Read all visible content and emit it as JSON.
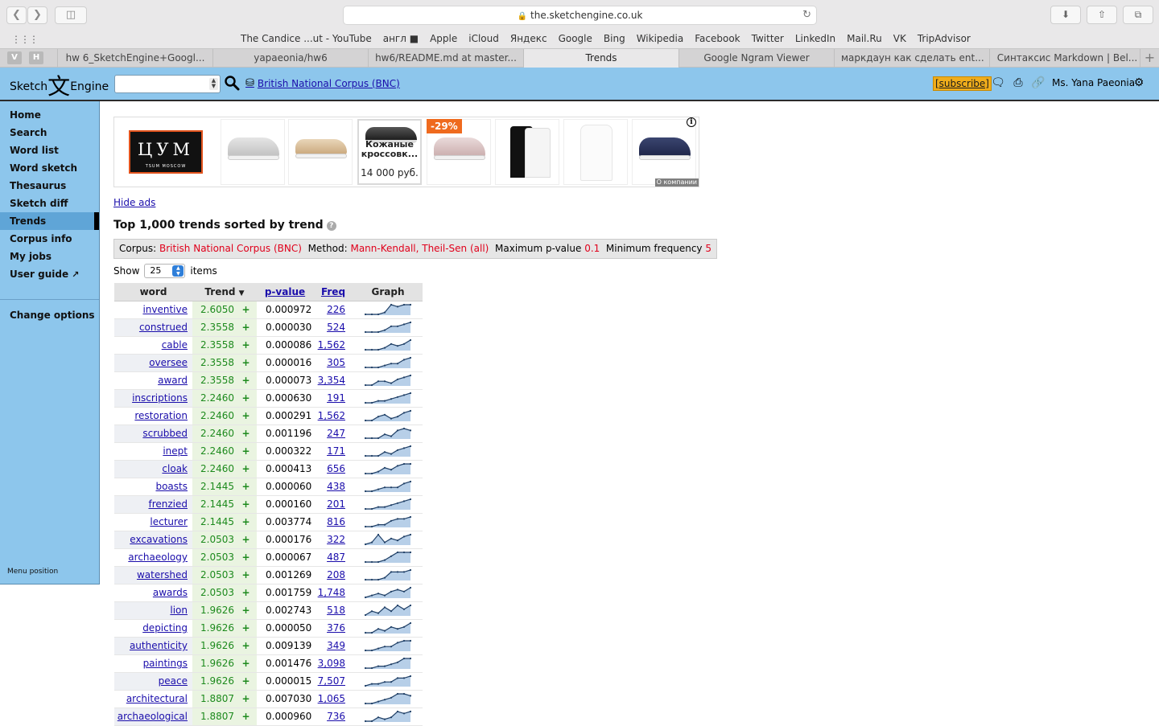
{
  "browser": {
    "url": "the.sketchengine.co.uk",
    "bookmarks": [
      "The Candice ...ut - YouTube",
      "англ ■",
      "Apple",
      "iCloud",
      "Яндекс",
      "Google",
      "Bing",
      "Wikipedia",
      "Facebook",
      "Twitter",
      "LinkedIn",
      "Mail.Ru",
      "VK",
      "TripAdvisor"
    ],
    "pinned_tabs": [
      "V",
      "H"
    ],
    "tabs": [
      {
        "label": "hw 6_SketchEngine+Googl...",
        "active": false
      },
      {
        "label": "yapaeonia/hw6",
        "active": false
      },
      {
        "label": "hw6/README.md at master...",
        "active": false
      },
      {
        "label": "Trends",
        "active": true
      },
      {
        "label": "Google Ngram Viewer",
        "active": false
      },
      {
        "label": "маркдаун как сделать ent...",
        "active": false
      },
      {
        "label": "Синтаксис Markdown | Bel...",
        "active": false
      }
    ]
  },
  "header": {
    "logo_left": "Sketch",
    "logo_glyph": "文",
    "logo_right": "Engine",
    "corpus_link": "British National Corpus (BNC)",
    "subscribe_label": "[subscribe]",
    "user_name": "Ms. Yana Paeonia"
  },
  "sidebar": {
    "items": [
      {
        "label": "Home",
        "active": false
      },
      {
        "label": "Search",
        "active": false
      },
      {
        "label": "Word list",
        "active": false
      },
      {
        "label": "Word sketch",
        "active": false
      },
      {
        "label": "Thesaurus",
        "active": false
      },
      {
        "label": "Sketch diff",
        "active": false
      },
      {
        "label": "Trends",
        "active": true
      },
      {
        "label": "Corpus info",
        "active": false
      },
      {
        "label": "My jobs",
        "active": false
      },
      {
        "label": "User guide",
        "active": false
      }
    ],
    "change_options": "Change options",
    "menu_position": "Menu position"
  },
  "ads": {
    "brand": "ЦУМ",
    "brand_sub": "TSUM MOSCOW",
    "featured_caption": "Кожаные кроссовк...",
    "featured_price": "14 000 руб.",
    "discount": "-29%",
    "company_label": "О компании"
  },
  "content": {
    "hide_ads": "Hide ads",
    "title": "Top 1,000 trends sorted by trend",
    "settings": {
      "corpus_label": "Corpus:",
      "corpus_value": "British National Corpus (BNC)",
      "method_label": "Method:",
      "method_value": "Mann-Kendall, Theil-Sen (all)",
      "pvalue_label": "Maximum p-value",
      "pvalue_value": "0.1",
      "minfreq_label": "Minimum frequency",
      "minfreq_value": "5"
    },
    "show_label": "Show",
    "show_value": "25",
    "items_label": "items"
  },
  "table": {
    "headers": {
      "word": "word",
      "trend": "Trend",
      "pvalue": "p-value",
      "freq": "Freq",
      "graph": "Graph"
    },
    "rows": [
      {
        "word": "inventive",
        "trend": "2.6050",
        "sign": "+",
        "p": "0.000972",
        "freq": "226",
        "spark": [
          1,
          1,
          1,
          2,
          6,
          5,
          6,
          6
        ]
      },
      {
        "word": "construed",
        "trend": "2.3558",
        "sign": "+",
        "p": "0.000030",
        "freq": "524",
        "spark": [
          1,
          1,
          1,
          2,
          4,
          4,
          5,
          6
        ]
      },
      {
        "word": "cable",
        "trend": "2.3558",
        "sign": "+",
        "p": "0.000086",
        "freq": "1,562",
        "spark": [
          1,
          1,
          1,
          2,
          4,
          3,
          4,
          6
        ]
      },
      {
        "word": "oversee",
        "trend": "2.3558",
        "sign": "+",
        "p": "0.000016",
        "freq": "305",
        "spark": [
          1,
          1,
          1,
          2,
          3,
          3,
          5,
          6
        ]
      },
      {
        "word": "award",
        "trend": "2.3558",
        "sign": "+",
        "p": "0.000073",
        "freq": "3,354",
        "spark": [
          1,
          1,
          3,
          3,
          2,
          4,
          5,
          6
        ]
      },
      {
        "word": "inscriptions",
        "trend": "2.2460",
        "sign": "+",
        "p": "0.000630",
        "freq": "191",
        "spark": [
          1,
          1,
          2,
          2,
          3,
          4,
          5,
          6
        ]
      },
      {
        "word": "restoration",
        "trend": "2.2460",
        "sign": "+",
        "p": "0.000291",
        "freq": "1,562",
        "spark": [
          1,
          1,
          3,
          4,
          2,
          3,
          5,
          6
        ]
      },
      {
        "word": "scrubbed",
        "trend": "2.2460",
        "sign": "+",
        "p": "0.001196",
        "freq": "247",
        "spark": [
          1,
          1,
          1,
          3,
          2,
          5,
          6,
          5
        ]
      },
      {
        "word": "inept",
        "trend": "2.2460",
        "sign": "+",
        "p": "0.000322",
        "freq": "171",
        "spark": [
          1,
          1,
          1,
          3,
          2,
          4,
          5,
          6
        ]
      },
      {
        "word": "cloak",
        "trend": "2.2460",
        "sign": "+",
        "p": "0.000413",
        "freq": "656",
        "spark": [
          1,
          1,
          2,
          4,
          3,
          5,
          6,
          6
        ]
      },
      {
        "word": "boasts",
        "trend": "2.1445",
        "sign": "+",
        "p": "0.000060",
        "freq": "438",
        "spark": [
          1,
          1,
          2,
          3,
          3,
          3,
          5,
          6
        ]
      },
      {
        "word": "frenzied",
        "trend": "2.1445",
        "sign": "+",
        "p": "0.000160",
        "freq": "201",
        "spark": [
          1,
          1,
          2,
          2,
          3,
          4,
          5,
          6
        ]
      },
      {
        "word": "lecturer",
        "trend": "2.1445",
        "sign": "+",
        "p": "0.003774",
        "freq": "816",
        "spark": [
          1,
          1,
          2,
          2,
          4,
          5,
          5,
          6
        ]
      },
      {
        "word": "excavations",
        "trend": "2.0503",
        "sign": "+",
        "p": "0.000176",
        "freq": "322",
        "spark": [
          1,
          2,
          6,
          2,
          4,
          3,
          5,
          6
        ]
      },
      {
        "word": "archaeology",
        "trend": "2.0503",
        "sign": "+",
        "p": "0.000067",
        "freq": "487",
        "spark": [
          1,
          1,
          1,
          2,
          4,
          6,
          6,
          6
        ]
      },
      {
        "word": "watershed",
        "trend": "2.0503",
        "sign": "+",
        "p": "0.001269",
        "freq": "208",
        "spark": [
          1,
          1,
          1,
          2,
          5,
          5,
          5,
          6
        ]
      },
      {
        "word": "awards",
        "trend": "2.0503",
        "sign": "+",
        "p": "0.001759",
        "freq": "1,748",
        "spark": [
          1,
          2,
          3,
          2,
          4,
          5,
          4,
          6
        ]
      },
      {
        "word": "lion",
        "trend": "1.9626",
        "sign": "+",
        "p": "0.002743",
        "freq": "518",
        "spark": [
          1,
          3,
          2,
          5,
          3,
          6,
          4,
          6
        ]
      },
      {
        "word": "depicting",
        "trend": "1.9626",
        "sign": "+",
        "p": "0.000050",
        "freq": "376",
        "spark": [
          1,
          1,
          3,
          2,
          4,
          3,
          4,
          6
        ]
      },
      {
        "word": "authenticity",
        "trend": "1.9626",
        "sign": "+",
        "p": "0.009139",
        "freq": "349",
        "spark": [
          1,
          1,
          2,
          3,
          3,
          5,
          6,
          6
        ]
      },
      {
        "word": "paintings",
        "trend": "1.9626",
        "sign": "+",
        "p": "0.001476",
        "freq": "3,098",
        "spark": [
          1,
          1,
          2,
          2,
          3,
          4,
          6,
          6
        ]
      },
      {
        "word": "peace",
        "trend": "1.9626",
        "sign": "+",
        "p": "0.000015",
        "freq": "7,507",
        "spark": [
          1,
          2,
          2,
          3,
          3,
          5,
          5,
          6
        ]
      },
      {
        "word": "architectural",
        "trend": "1.8807",
        "sign": "+",
        "p": "0.007030",
        "freq": "1,065",
        "spark": [
          1,
          1,
          2,
          3,
          4,
          6,
          6,
          5
        ]
      },
      {
        "word": "archaeological",
        "trend": "1.8807",
        "sign": "+",
        "p": "0.000960",
        "freq": "736",
        "spark": [
          1,
          1,
          3,
          2,
          3,
          6,
          5,
          6
        ]
      }
    ]
  },
  "colors": {
    "sidebar_bg": "#8dc6ec",
    "sidebar_active": "#5fa5d7",
    "trend_green": "#1d8a1d",
    "highlight_red": "#e0001b",
    "link": "#1a0dab"
  }
}
